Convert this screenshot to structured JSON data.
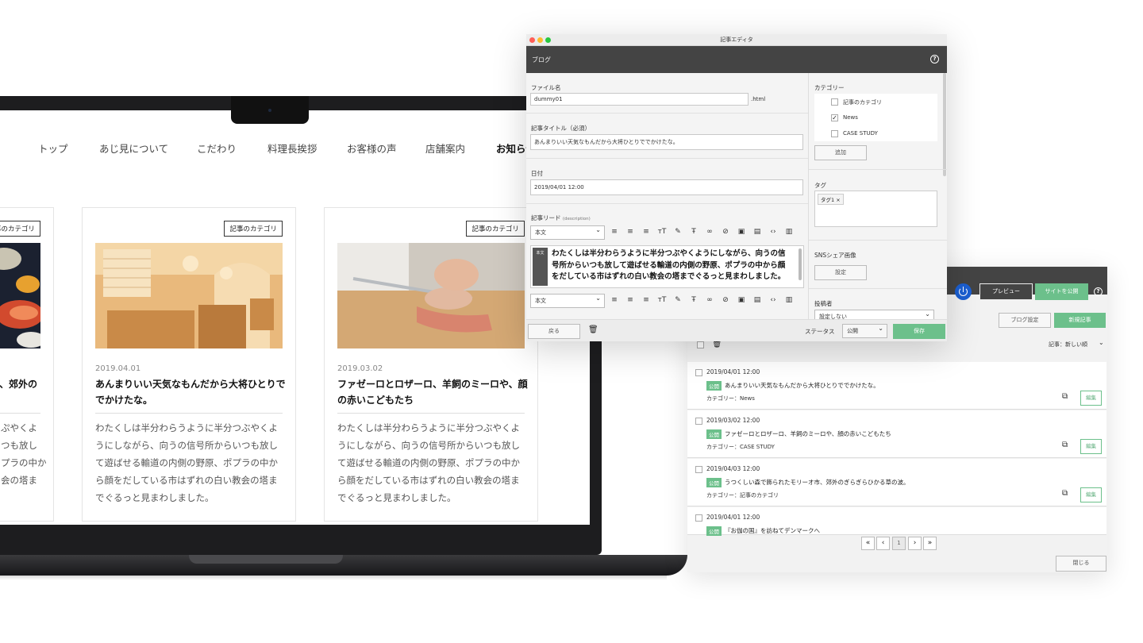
{
  "site": {
    "nav": [
      "トップ",
      "あじ見について",
      "こだわり",
      "料理長挨拶",
      "お客様の声",
      "店舗案内",
      "お知らせ"
    ],
    "cards": [
      {
        "badge": "記事のカテゴリ",
        "date": "",
        "title": "、郊外の",
        "body": "ぷやくよ\nつも放し\nプラの中か\n会の塔ま"
      },
      {
        "badge": "記事のカテゴリ",
        "date": "2019.04.01",
        "title": "あんまりいい天気なもんだから大将ひとりででかけたな。",
        "body": "わたくしは半分わらうように半分つぶやくようにしながら、向うの信号所からいつも放して遊ばせる輸道の内側の野原、ポプラの中から顔をだしている市はずれの白い教会の塔までぐるっと見まわしました。"
      },
      {
        "badge": "記事のカテゴリ",
        "date": "2019.03.02",
        "title": "ファゼーロとロザーロ、羊飼のミーロや、顔の赤いこどもたち",
        "body": "わたくしは半分わらうように半分つぶやくようにしながら、向うの信号所からいつも放して遊ばせる輸道の内側の野原、ポプラの中から顔をだしている市はずれの白い教会の塔までぐるっと見まわしました。"
      }
    ]
  },
  "editor": {
    "window_title": "記事エディタ",
    "header": "ブログ",
    "file_label": "ファイル名",
    "file_value": "dummy01",
    "file_ext": ".html",
    "title_label": "記事タイトル（必須）",
    "title_value": "あんまりいい天気なもんだから大将ひとりででかけたな。",
    "date_label": "日付",
    "date_value": "2019/04/01 12:00",
    "lead_label": "記事リード",
    "lead_sub": "(description)",
    "block_type": "本文",
    "block_tag": "本文",
    "body_text": "わたくしは半分わらうように半分つぶやくようにしながら、向うの信号所からいつも放して遊ばせる輸道の内側の野原、ポプラの中から顔をだしている市はずれの白い教会の塔までぐるっと見まわしました。",
    "category_label": "カテゴリー",
    "categories": [
      {
        "name": "記事のカテゴリ",
        "checked": false
      },
      {
        "name": "News",
        "checked": true
      },
      {
        "name": "CASE STUDY",
        "checked": false
      }
    ],
    "add_button": "追加",
    "tag_label": "タグ",
    "tag_value": "タグ1",
    "sns_label": "SNSシェア画像",
    "sns_button": "設定",
    "author_label": "投稿者",
    "author_value": "設定しない",
    "back_button": "戻る",
    "status_label": "ステータス",
    "status_value": "公開",
    "save_button": "保存"
  },
  "manager": {
    "preview_button": "プレビュー",
    "publish_button": "サイトを公開",
    "blog_settings_button": "ブログ設定",
    "new_post_button": "新規記事",
    "sort_label": "記事：新しい順",
    "published_label": "公開",
    "edit_label": "編集",
    "posts": [
      {
        "date": "2019/04/01 12:00",
        "title": "あんまりいい天気なもんだから大将ひとりででかけたな。",
        "category": "カテゴリー：News"
      },
      {
        "date": "2019/03/02 12:00",
        "title": "ファゼーロとロザーロ、羊飼のミーロや、顔の赤いこどもたち",
        "category": "カテゴリー：CASE STUDY"
      },
      {
        "date": "2019/04/03 12:00",
        "title": "うつくしい森で飾られたモリーオ市、郊外のぎらぎらひかる草の波。",
        "category": "カテゴリー：記事のカテゴリ"
      },
      {
        "date": "2019/04/01 12:00",
        "title": "『お伽の国』を訪ねてデンマークへ",
        "category": ""
      }
    ],
    "pager": [
      "«",
      "‹",
      "1",
      "›",
      "»"
    ],
    "close_button": "閉じる"
  }
}
